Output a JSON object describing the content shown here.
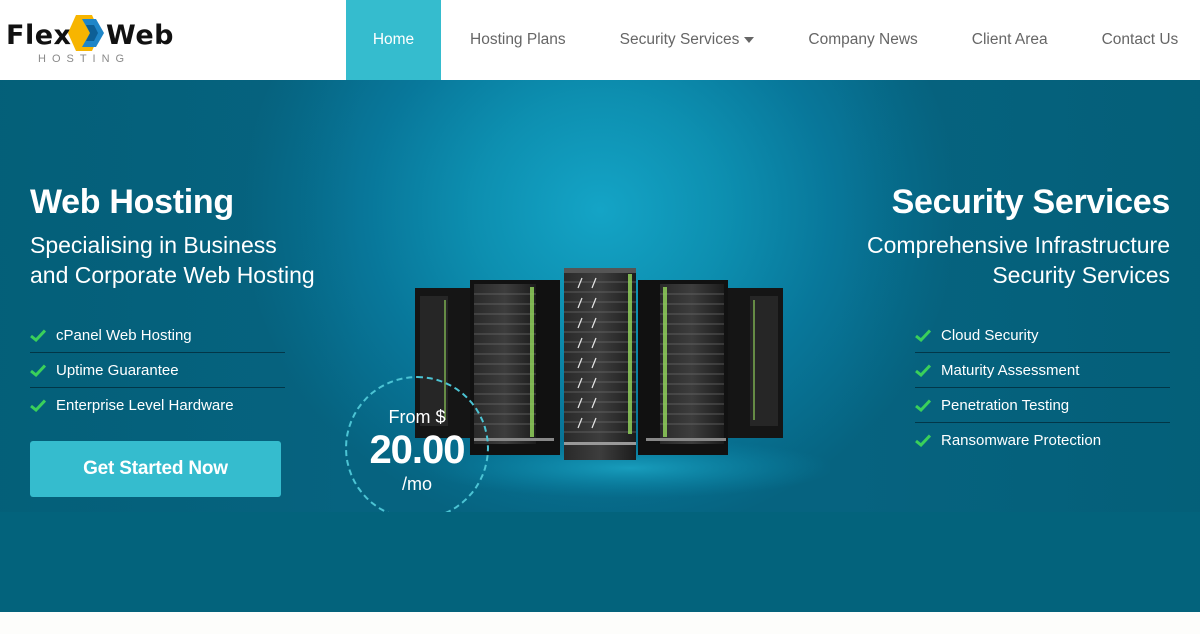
{
  "brand": {
    "name_left": "Flex",
    "name_right": "Web",
    "tagline": "HOSTING",
    "colors": {
      "accent": "#35bcce",
      "hero_dark": "#03637c",
      "check": "#3ad05a",
      "logo_yellow": "#f7b500",
      "logo_blue": "#1f86c8"
    }
  },
  "nav": {
    "items": [
      {
        "label": "Home",
        "active": true
      },
      {
        "label": "Hosting Plans"
      },
      {
        "label": "Security Services",
        "dropdown": true
      },
      {
        "label": "Company News"
      },
      {
        "label": "Client Area"
      },
      {
        "label": "Contact Us"
      }
    ]
  },
  "hero": {
    "left": {
      "title": "Web Hosting",
      "subtitle_line1": "Specialising in Business",
      "subtitle_line2": "and Corporate Web Hosting",
      "features": [
        "cPanel Web Hosting",
        "Uptime Guarantee",
        "Enterprise Level Hardware"
      ],
      "cta_label": "Get Started Now"
    },
    "price": {
      "from_label": "From $",
      "amount": "20.00",
      "unit": "/mo"
    },
    "right": {
      "title": "Security Services",
      "subtitle_line1": "Comprehensive Infrastructure",
      "subtitle_line2": "Security Services",
      "features": [
        "Cloud Security",
        "Maturity Assessment",
        "Penetration Testing",
        "Ransomware Protection"
      ]
    },
    "image_icon": "server-racks-icon",
    "check_icon": "check-icon"
  }
}
